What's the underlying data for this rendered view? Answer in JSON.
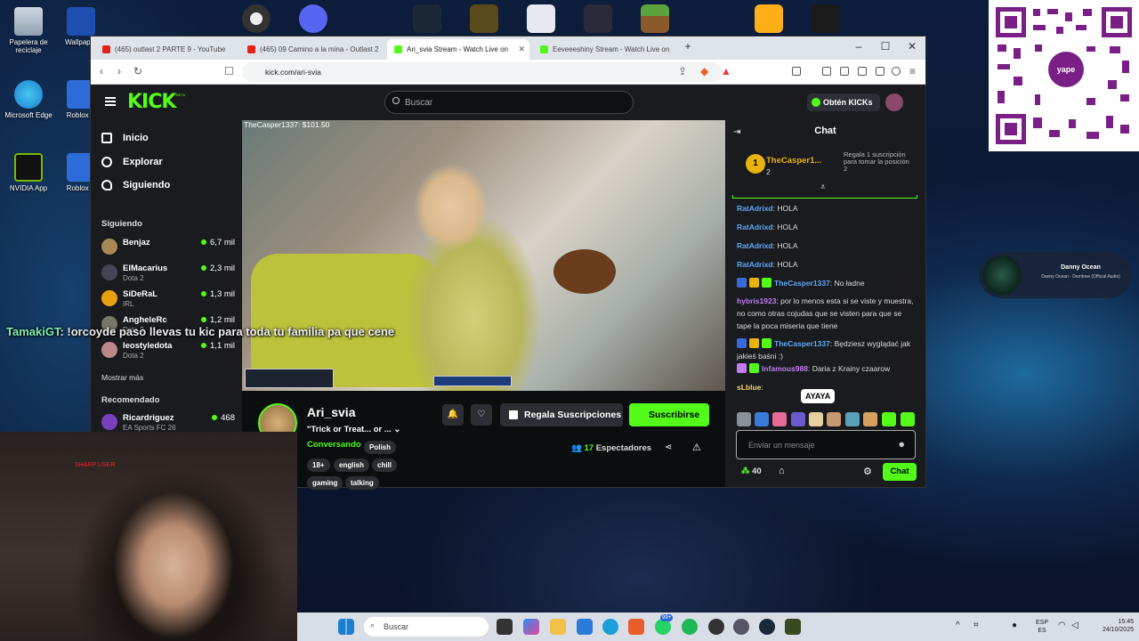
{
  "desktop": {
    "icons": [
      {
        "label": "Papelera de reciclaje"
      },
      {
        "label": "Wallpaper"
      },
      {
        "label": "Microsoft Edge"
      },
      {
        "label": "Roblox S"
      },
      {
        "label": "NVIDIA App"
      },
      {
        "label": "Roblox P"
      }
    ],
    "qr_brand": "yape",
    "music_widget": {
      "title": "Danny Ocean",
      "subtitle": "Danny Ocean - Dembow (Official Audio)"
    }
  },
  "browser": {
    "tabs": [
      {
        "title": "(465) outlast 2 PARTE 9 - YouTube",
        "active": false
      },
      {
        "title": "(465) 09 Camino a la mina - Outlast 2",
        "active": false
      },
      {
        "title": "Ari_svia Stream - Watch Live on",
        "active": true
      },
      {
        "title": "Eeveeeshiny Stream - Watch Live on",
        "active": false
      }
    ],
    "new_tab": "+",
    "url": "kick.com/ari-svia"
  },
  "kick": {
    "logo": "KICK",
    "beta": "BETA",
    "search_placeholder": "Buscar",
    "get_kicks": "Obtén KICKs",
    "nav": [
      {
        "label": "Inicio"
      },
      {
        "label": "Explorar"
      },
      {
        "label": "Siguiendo"
      }
    ],
    "following_header": "Siguiendo",
    "following": [
      {
        "name": "Benjaz",
        "game": "",
        "viewers": "6,7 mil"
      },
      {
        "name": "ElMacarius",
        "game": "Dota 2",
        "viewers": "2,3 mil"
      },
      {
        "name": "SiDeRaL",
        "game": "IRL",
        "viewers": "1,3 mil"
      },
      {
        "name": "AngheleRc",
        "game": "Dota 2",
        "viewers": "1,2 mil"
      },
      {
        "name": "leostyledota",
        "game": "Dota 2",
        "viewers": "1,1 mil"
      }
    ],
    "show_more": "Mostrar más",
    "recommended_header": "Recomendado",
    "recommended": [
      {
        "name": "Ricardriguez",
        "game": "EA Sports FC 26",
        "viewers": "468"
      }
    ],
    "video": {
      "donor": "TheCasper1337: $101.50",
      "overlay_user": "TamakiGT",
      "overlay_text": ": !orcoyde paso llevas tu kic para toda tu familia pa que cene"
    },
    "stream": {
      "name": "Ari_svia",
      "title": "\"Trick or Treat... or ...",
      "category": "Conversando",
      "language": "Polish",
      "tags": [
        "18+",
        "english",
        "chill",
        "gaming",
        "talking"
      ],
      "gift_label": "Regala Suscripciones",
      "subscribe_label": "Suscribirse",
      "viewers_count": "17",
      "viewers_label": "Espectadores"
    },
    "chat": {
      "title": "Chat",
      "pinned": {
        "rank": "1",
        "user": "TheCasper1...",
        "count": "2",
        "message": "Regala 1 suscripción para tomar la posición 2"
      },
      "messages": [
        {
          "user": "RatAdrixd",
          "text": ": HOLA",
          "color": "#5fa8f5",
          "badges": 0
        },
        {
          "user": "RatAdrixd",
          "text": ": HOLA",
          "color": "#5fa8f5",
          "badges": 0
        },
        {
          "user": "RatAdrixd",
          "text": ": HOLA",
          "color": "#5fa8f5",
          "badges": 0
        },
        {
          "user": "RatAdrixd",
          "text": ": HOLA",
          "color": "#5fa8f5",
          "badges": 0
        },
        {
          "user": "TheCasper1337",
          "text": ": No ładne",
          "color": "#5fa8f5",
          "badges": 3
        },
        {
          "user": "hybris1923",
          "text": ": por lo menos esta si se viste y muestra, no como otras cojudas que se visten para que se tape la poca miseria que tiene",
          "color": "#c07df0",
          "badges": 0
        },
        {
          "user": "TheCasper1337",
          "text": ": Będziesz wyglądać jak jakieś baśni :)",
          "color": "#5fa8f5",
          "badges": 3
        },
        {
          "user": "Infamous988",
          "text": ": Daria z Krainy czaarow",
          "color": "#c07df0",
          "badges": 2
        },
        {
          "user": "sLblue",
          "text": ":",
          "color": "#f5d65f",
          "badges": 0
        }
      ],
      "tooltip": "AYAYA",
      "input_placeholder": "Enviar un mensaje",
      "points": "40",
      "send_label": "Chat"
    }
  },
  "taskbar": {
    "search_placeholder": "Buscar",
    "badge": "99+",
    "language": "ESP",
    "region": "ES",
    "time": "15:45",
    "date": "24/10/2025"
  },
  "webcam": {
    "caption": "SHARP USER"
  },
  "colors": {
    "kick_green": "#53fc18",
    "kick_bg": "#191b1f"
  }
}
